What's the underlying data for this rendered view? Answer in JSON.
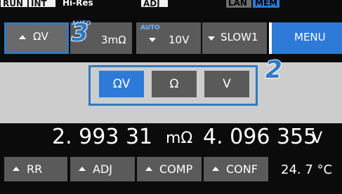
{
  "status_bar": {
    "run": "RUN",
    "int": "INT",
    "hires": "Hi-Res",
    "adj": "ADJ",
    "lan": "LAN",
    "mem": "MEM"
  },
  "toolbar": {
    "func_label": "ΩV",
    "range_auto": "AUTO",
    "range_value": "3mΩ",
    "volt_auto": "AUTO",
    "volt_value": "10V",
    "speed_value": "SLOW1",
    "menu_label": "MENU"
  },
  "function_selector": {
    "options": [
      "ΩV",
      "Ω",
      "V"
    ],
    "selected": "ΩV"
  },
  "measurement": {
    "resistance_value": "2. 993 31",
    "resistance_unit": "mΩ",
    "voltage_value": "4. 096 355",
    "voltage_unit": "V"
  },
  "function_keys": {
    "rr": "RR",
    "adj": "ADJ",
    "comp": "COMP",
    "conf": "CONF",
    "temperature": "24. 7 °C"
  },
  "callouts": {
    "c2": "2",
    "c3": "3"
  },
  "colors": {
    "accent_blue": "#2d7ad8",
    "callout_blue": "#2f7ac4",
    "button_gray": "#5a5a5a",
    "panel_gray": "#cdcdcd"
  }
}
